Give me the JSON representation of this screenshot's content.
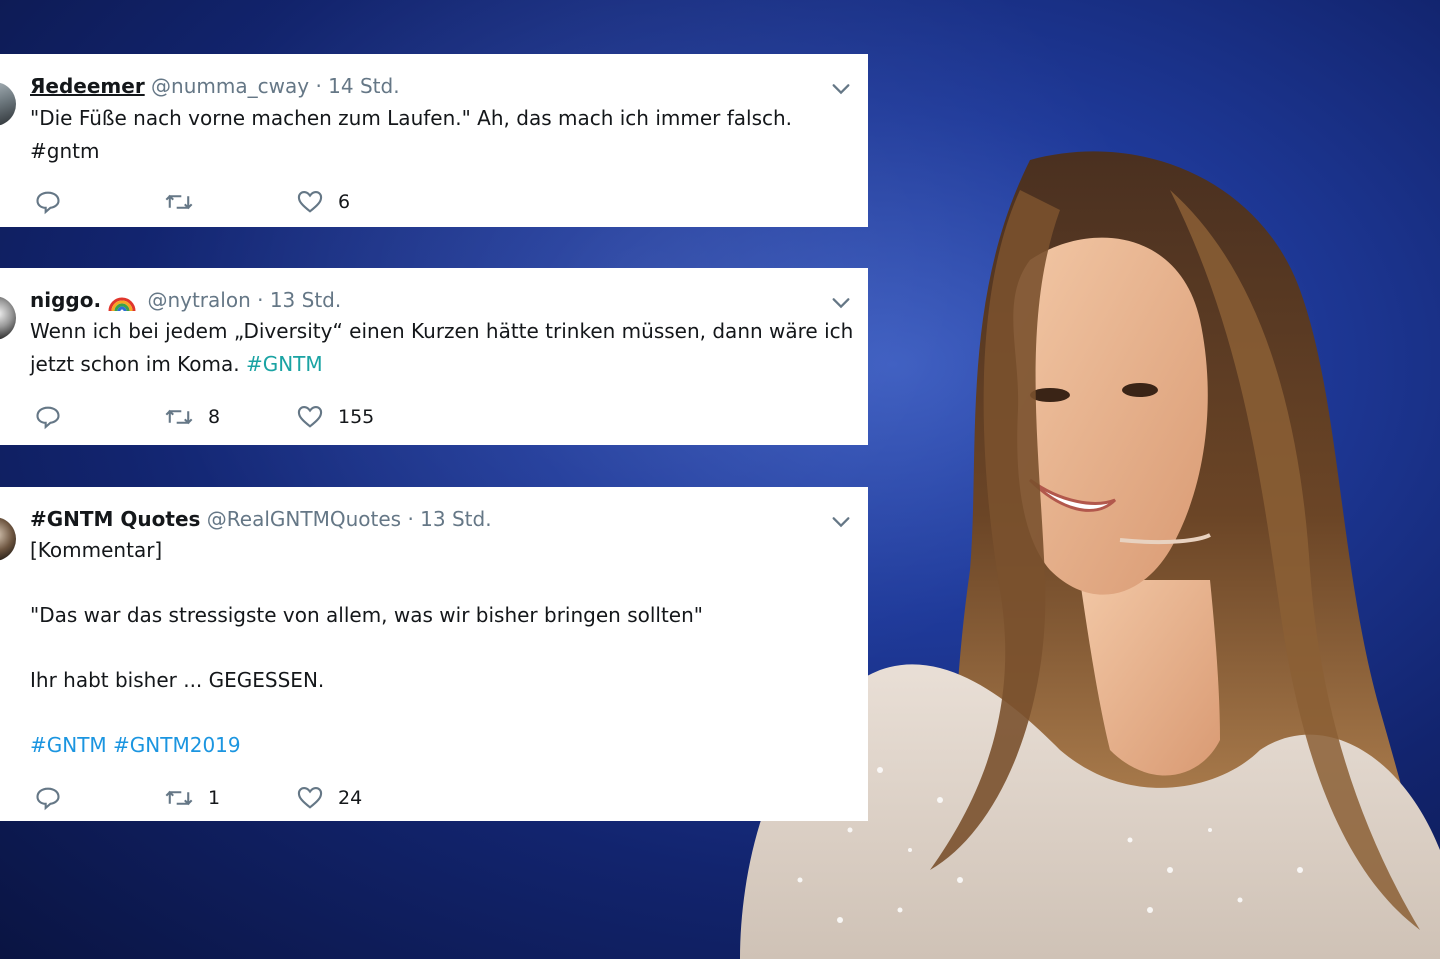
{
  "tweets": [
    {
      "display_name": "Яedeemer",
      "handle": "@numma_cway",
      "separator": "·",
      "time": "14 Std.",
      "text_line1": "\"Die Füße nach vorne machen zum Laufen.\" Ah, das mach ich immer falsch.",
      "hashtags": "#gntm",
      "retweets": "",
      "likes": "6"
    },
    {
      "display_name": "niggo.",
      "handle": "@nytralon",
      "separator": "·",
      "time": "13 Std.",
      "text_line1": "Wenn ich bei jedem „Diversity“ einen Kurzen hätte trinken müssen, dann wäre ich",
      "text_line2": "jetzt schon im Koma.",
      "hashtags": "#GNTM",
      "retweets": "8",
      "likes": "155"
    },
    {
      "display_name": "#GNTM Quotes",
      "handle": "@RealGNTMQuotes",
      "separator": "·",
      "time": "13 Std.",
      "text_line1": "[Kommentar]",
      "text_line2": "\"Das war das stressigste von allem, was wir bisher bringen sollten\"",
      "text_line3": "Ihr habt bisher ... GEGESSEN.",
      "hashtags": "#GNTM #GNTM2019",
      "retweets": "1",
      "likes": "24"
    }
  ],
  "icons": {
    "reply": "reply-icon",
    "retweet": "retweet-icon",
    "like": "heart-icon",
    "more": "chevron-down-icon",
    "emoji": "rainbow-emoji-icon"
  },
  "colors": {
    "background": "#1f3a9a",
    "card": "#ffffff",
    "text": "#14171a",
    "muted": "#657786",
    "hashtag_blue": "#1b95e0",
    "hashtag_teal": "#1aa3a3"
  }
}
